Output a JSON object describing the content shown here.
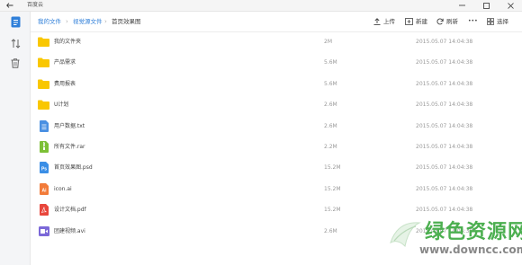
{
  "window": {
    "title": "百度云"
  },
  "breadcrumb": {
    "items": [
      "我的文件",
      "视觉源文件",
      "首页效果图"
    ]
  },
  "toolbar": {
    "upload": "上传",
    "new": "新建",
    "refresh": "刷新",
    "more": "•••",
    "select": "选择"
  },
  "files": [
    {
      "name": "我的文件夹",
      "size": "2M",
      "date": "2015.05.07  14:04:38",
      "type": "folder"
    },
    {
      "name": "产品需求",
      "size": "5.6M",
      "date": "2015.05.07  14:04:38",
      "type": "folder"
    },
    {
      "name": "费用报表",
      "size": "5.6M",
      "date": "2015.05.07  14:04:38",
      "type": "folder"
    },
    {
      "name": "U计划",
      "size": "2.6M",
      "date": "2015.05.07  14:04:38",
      "type": "folder"
    },
    {
      "name": "用户数据.txt",
      "size": "2.6M",
      "date": "2015.05.07  14:04:38",
      "type": "txt"
    },
    {
      "name": "所有文件.rar",
      "size": "2.2M",
      "date": "2015.05.07  14:04:38",
      "type": "rar"
    },
    {
      "name": "首页效果图.psd",
      "size": "15.2M",
      "date": "2015.05.07  14:04:38",
      "type": "psd"
    },
    {
      "name": "icon.ai",
      "size": "15.2M",
      "date": "2015.05.07  14:04:38",
      "type": "ai"
    },
    {
      "name": "设计文档.pdf",
      "size": "15.2M",
      "date": "2015.05.07  14:04:38",
      "type": "pdf"
    },
    {
      "name": "团建视频.avi",
      "size": "2.6M",
      "date": "2015.05.07  14:04:38",
      "type": "avi"
    }
  ],
  "icon_labels": {
    "psd": "Ps",
    "ai": "Ai"
  },
  "watermark": {
    "text": "绿色资源网",
    "url": "www.downcc.com"
  },
  "colors": {
    "accent": "#2f7fd9",
    "folder": "#f9c700",
    "txt": "#4a90e2",
    "rar": "#7cc036",
    "psd": "#3a8ee6",
    "ai": "#f27b39",
    "pdf": "#e8463c",
    "avi": "#7b68d8",
    "watermark": "#4caf50"
  }
}
